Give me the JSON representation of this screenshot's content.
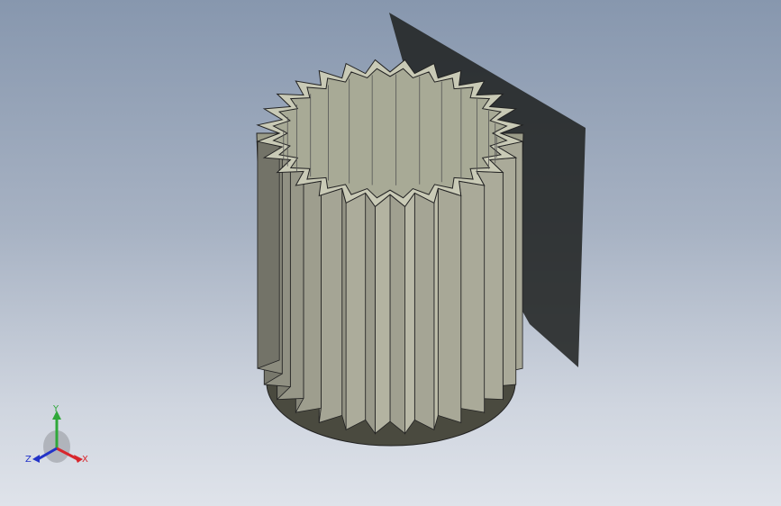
{
  "triad": {
    "x_label": "X",
    "y_label": "Y",
    "z_label": "Z",
    "x_color": "#d8262c",
    "y_color": "#2fa83a",
    "z_color": "#2233c8"
  },
  "model": {
    "fin_count": 28,
    "fin_color": "#b7b8a3",
    "base_color": "#4b4b40"
  }
}
